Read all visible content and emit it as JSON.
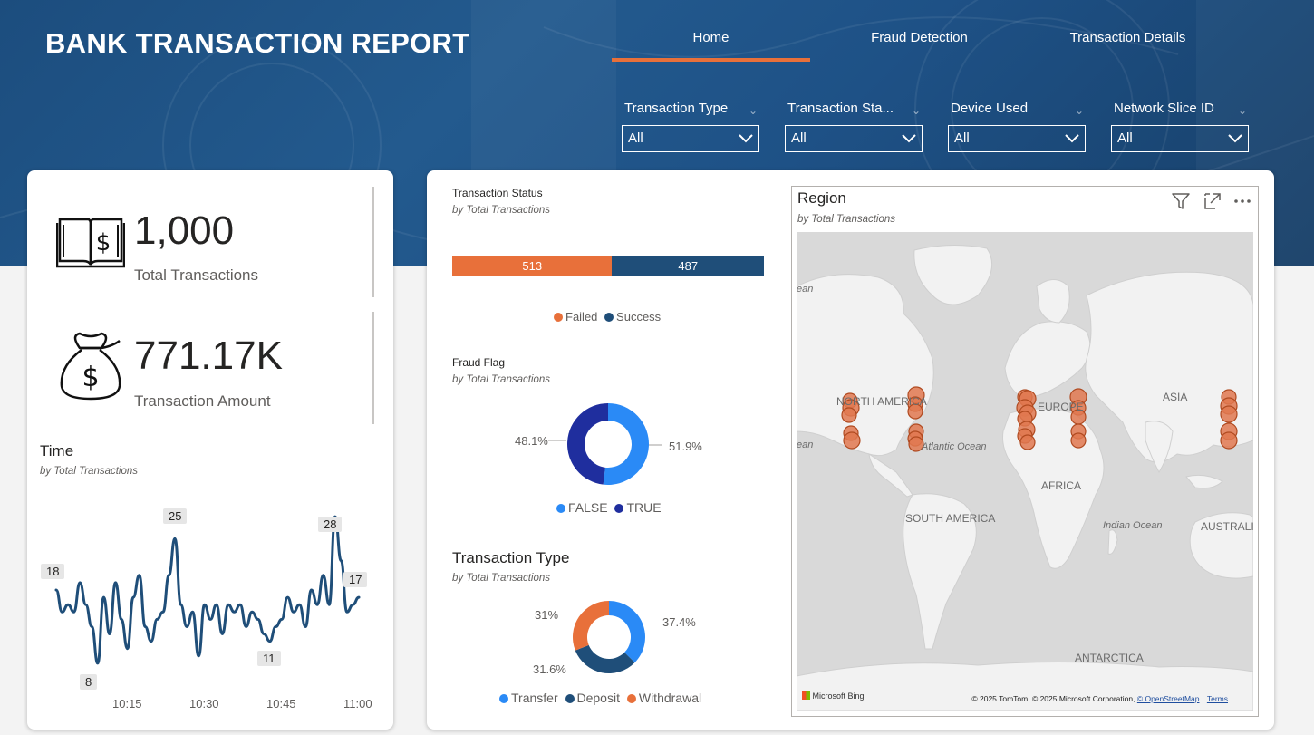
{
  "header": {
    "title": "BANK TRANSACTION REPORT",
    "tabs": [
      {
        "label": "Home",
        "active": true
      },
      {
        "label": "Fraud Detection",
        "active": false
      },
      {
        "label": "Transaction Details",
        "active": false
      }
    ]
  },
  "slicers": [
    {
      "label": "Transaction Type",
      "value": "All"
    },
    {
      "label": "Transaction Sta...",
      "value": "All"
    },
    {
      "label": "Device Used",
      "value": "All"
    },
    {
      "label": "Network Slice ID",
      "value": "All"
    }
  ],
  "kpis": {
    "transactions": {
      "value": "1,000",
      "label": "Total Transactions",
      "icon": "ledger-dollar-icon"
    },
    "amount": {
      "value": "771.17K",
      "label": "Transaction Amount",
      "icon": "money-bag-icon"
    }
  },
  "time_chart": {
    "title": "Time",
    "subtitle": "by Total Transactions",
    "x_ticks": [
      "10:15",
      "10:30",
      "10:45",
      "11:00"
    ],
    "labels": [
      "18",
      "8",
      "25",
      "11",
      "28",
      "17"
    ]
  },
  "status_chart": {
    "title": "Transaction Status",
    "subtitle": "by Total Transactions",
    "segments": [
      {
        "name": "Failed",
        "value": "513",
        "color": "#e8703a"
      },
      {
        "name": "Success",
        "value": "487",
        "color": "#1f4e79"
      }
    ]
  },
  "fraud_chart": {
    "title": "Fraud Flag",
    "subtitle": "by Total Transactions",
    "slices": [
      {
        "name": "FALSE",
        "pct": "51.9%",
        "color": "#2a8af6"
      },
      {
        "name": "TRUE",
        "pct": "48.1%",
        "color": "#1f2e9e"
      }
    ]
  },
  "type_chart": {
    "title": "Transaction Type",
    "subtitle": "by Total Transactions",
    "slices": [
      {
        "name": "Transfer",
        "pct": "37.4%",
        "color": "#2a8af6"
      },
      {
        "name": "Deposit",
        "pct": "31.6%",
        "color": "#1f4e79"
      },
      {
        "name": "Withdrawal",
        "pct": "31%",
        "color": "#e8703a"
      }
    ]
  },
  "map": {
    "title": "Region",
    "subtitle": "by Total Transactions",
    "labels": {
      "north_america": "NORTH AMERICA",
      "europe": "EUROPE",
      "asia": "ASIA",
      "africa": "AFRICA",
      "south_america": "SOUTH AMERICA",
      "antarctica": "ANTARCTICA",
      "australia": "AUSTRALIA",
      "atlantic": "Atlantic Ocean",
      "indian": "Indian Ocean",
      "ocean_edge_1": "ean",
      "ocean_edge_2": "ean"
    },
    "bing": "Microsoft Bing",
    "copyright": "© 2025 TomTom, © 2025 Microsoft Corporation,",
    "osm": "© OpenStreetMap",
    "terms": "Terms"
  },
  "chart_data": [
    {
      "type": "line",
      "title": "Time",
      "subtitle": "by Total Transactions",
      "x_ticks": [
        "10:15",
        "10:30",
        "10:45",
        "11:00"
      ],
      "values": [
        18,
        15,
        16,
        15,
        19,
        16,
        13,
        8,
        17,
        12,
        19,
        14,
        10,
        17,
        20,
        13,
        11,
        14,
        15,
        20,
        25,
        16,
        13,
        15,
        9,
        16,
        14,
        16,
        12,
        16,
        15,
        16,
        13,
        15,
        14,
        12,
        11,
        13,
        14,
        17,
        15,
        16,
        13,
        18,
        16,
        20,
        16,
        28,
        22,
        15,
        16,
        17
      ],
      "data_labels": [
        {
          "index": 0,
          "value": 18
        },
        {
          "index": 7,
          "value": 8
        },
        {
          "index": 20,
          "value": 25
        },
        {
          "index": 36,
          "value": 11
        },
        {
          "index": 47,
          "value": 28
        },
        {
          "index": 51,
          "value": 17
        }
      ]
    },
    {
      "type": "bar",
      "title": "Transaction Status",
      "subtitle": "by Total Transactions",
      "categories": [
        "Failed",
        "Success"
      ],
      "values": [
        513,
        487
      ]
    },
    {
      "type": "pie",
      "title": "Fraud Flag",
      "subtitle": "by Total Transactions",
      "categories": [
        "FALSE",
        "TRUE"
      ],
      "values": [
        51.9,
        48.1
      ]
    },
    {
      "type": "pie",
      "title": "Transaction Type",
      "subtitle": "by Total Transactions",
      "categories": [
        "Transfer",
        "Deposit",
        "Withdrawal"
      ],
      "values": [
        37.4,
        31.6,
        31
      ]
    }
  ]
}
